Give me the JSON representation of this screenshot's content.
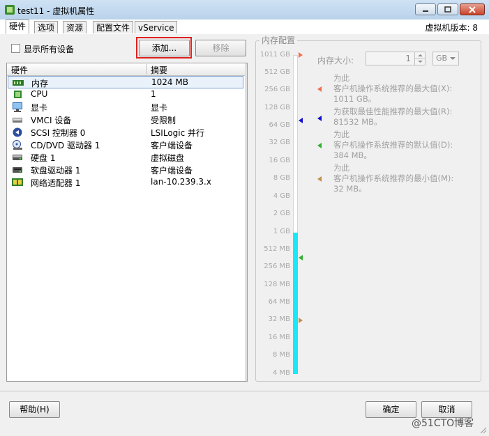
{
  "window": {
    "title": "test11 - 虚拟机属性",
    "version": "虚拟机版本: 8"
  },
  "tabs": [
    {
      "label": "硬件"
    },
    {
      "label": "选项"
    },
    {
      "label": "资源"
    },
    {
      "label": "配置文件"
    },
    {
      "label": "vService"
    }
  ],
  "hardware": {
    "show_all_label": "显示所有设备",
    "add_label": "添加...",
    "remove_label": "移除",
    "col_hardware": "硬件",
    "col_summary": "摘要",
    "rows": [
      {
        "name": "内存",
        "summary": "1024 MB",
        "icon": "memory-icon"
      },
      {
        "name": "CPU",
        "summary": "1",
        "icon": "cpu-icon"
      },
      {
        "name": "显卡",
        "summary": "显卡",
        "icon": "display-icon"
      },
      {
        "name": "VMCI 设备",
        "summary": "受限制",
        "icon": "vmci-icon"
      },
      {
        "name": "SCSI 控制器  0",
        "summary": "LSILogic 并行",
        "icon": "scsi-icon"
      },
      {
        "name": "CD/DVD 驱动器  1",
        "summary": "客户端设备",
        "icon": "cdrom-icon"
      },
      {
        "name": "硬盘  1",
        "summary": "虚拟磁盘",
        "icon": "harddisk-icon"
      },
      {
        "name": "软盘驱动器  1",
        "summary": "客户端设备",
        "icon": "floppy-icon"
      },
      {
        "name": "网络适配器  1",
        "summary": "lan-10.239.3.x",
        "icon": "network-icon"
      }
    ]
  },
  "memory": {
    "group_title": "内存配置",
    "size_label": "内存大小:",
    "size_value": "1",
    "unit": "GB",
    "scale": [
      "1011 GB",
      "512 GB",
      "256 GB",
      "128 GB",
      "64 GB",
      "32 GB",
      "16 GB",
      "8 GB",
      "4 GB",
      "2 GB",
      "1 GB",
      "512 MB",
      "256 MB",
      "128 MB",
      "64 MB",
      "32 MB",
      "16 MB",
      "8 MB",
      "4 MB"
    ],
    "notes": [
      {
        "line1": "为此",
        "line2": "客户机操作系统推荐的最大值(X):",
        "line3": "1011 GB。",
        "color": "#f07050"
      },
      {
        "line1": "为获取最佳性能推荐的最大值(R):",
        "line2": "81532 MB。",
        "color": "#1010d0"
      },
      {
        "line1": "为此",
        "line2": "客户机操作系统推荐的默认值(D):",
        "line3": "384 MB。",
        "color": "#30b030"
      },
      {
        "line1": "为此",
        "line2": "客户机操作系统推荐的最小值(M):",
        "line3": "32 MB。",
        "color": "#c09050"
      }
    ]
  },
  "footer": {
    "help_label": "帮助(H)",
    "ok_label": "确定",
    "cancel_label": "取消",
    "watermark": "@51CTO博客"
  }
}
